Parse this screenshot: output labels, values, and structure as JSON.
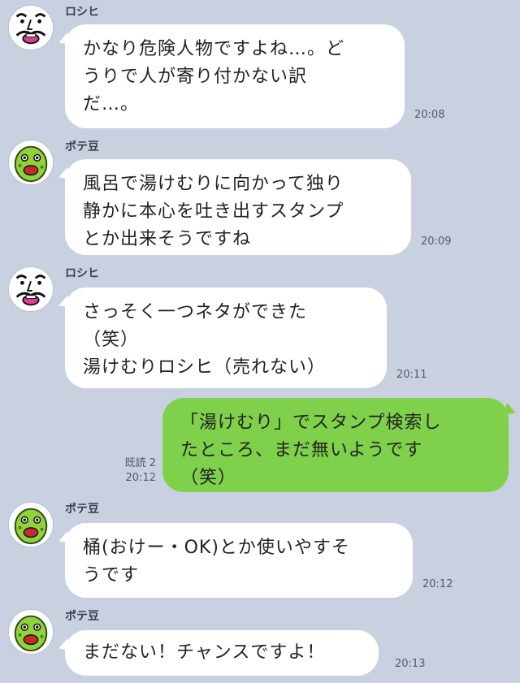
{
  "conversation": {
    "messages": [
      {
        "sender": "ロシヒ",
        "lines": [
          "かなり危険人物ですよね…。ど",
          "うりで人が寄り付かない訳",
          "だ…。"
        ],
        "time": "20:08"
      },
      {
        "sender": "ポテ豆",
        "lines": [
          "風呂で湯けむりに向かって独り",
          "静かに本心を吐き出すスタンプ",
          "とか出来そうですね"
        ],
        "time": "20:09"
      },
      {
        "sender": "ロシヒ",
        "lines": [
          "さっそく一つネタができた",
          "（笑）",
          "湯けむりロシヒ（売れない）"
        ],
        "time": "20:11"
      },
      {
        "sender": "me",
        "lines": [
          "「湯けむり」でスタンプ検索し",
          "たところ、まだ無いようです",
          "（笑）"
        ],
        "read": "既読 2",
        "time": "20:12"
      },
      {
        "sender": "ポテ豆",
        "lines": [
          "桶(おけー・OK)とか使いやすそ",
          "うです"
        ],
        "time": "20:12"
      },
      {
        "sender": "ポテ豆",
        "lines": [
          "まだない！チャンスですよ！"
        ],
        "time": "20:13"
      }
    ]
  },
  "icons": {
    "roshihi_avatar": "old-man-face-icon",
    "potemame_avatar": "green-bean-face-icon"
  },
  "colors": {
    "background": "#c9d0e0",
    "incoming_bubble": "#ffffff",
    "outgoing_bubble": "#7fd04a"
  }
}
